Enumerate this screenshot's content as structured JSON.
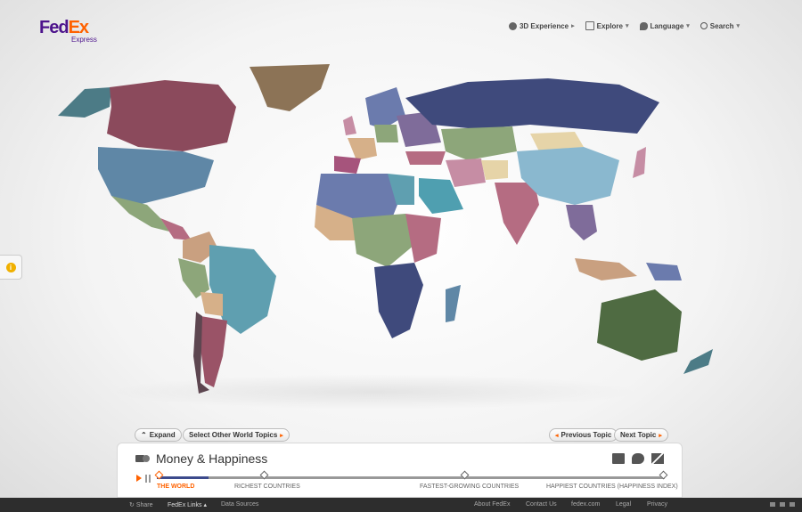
{
  "brand": {
    "logo_fed": "Fed",
    "logo_ex": "Ex",
    "logo_sub": "Express"
  },
  "topnav": [
    {
      "label": "3D Experience",
      "icon": "globe-icon",
      "arrow": "▸"
    },
    {
      "label": "Explore",
      "icon": "sitemap-icon",
      "arrow": "▾"
    },
    {
      "label": "Language",
      "icon": "speech-bubble-icon",
      "arrow": "▾"
    },
    {
      "label": "Search",
      "icon": "search-icon",
      "arrow": "▾"
    }
  ],
  "info_tab": {
    "label": "i"
  },
  "controls": {
    "expand": "Expand",
    "select_topics": "Select Other World Topics",
    "previous_topic": "Previous Topic",
    "next_topic": "Next Topic"
  },
  "panel": {
    "title": "Money & Happiness",
    "timeline": [
      {
        "label": "THE WORLD",
        "active": true
      },
      {
        "label": "RICHEST COUNTRIES",
        "active": false
      },
      {
        "label": "FASTEST-GROWING COUNTRIES",
        "active": false
      },
      {
        "label": "HAPPIEST COUNTRIES (HAPPINESS INDEX)",
        "active": false
      }
    ]
  },
  "footer": {
    "share": "Share",
    "fedex_links": "FedEx Links",
    "data_sources": "Data Sources",
    "about": "About FedEx",
    "contact": "Contact Us",
    "site": "fedex.com",
    "legal": "Legal",
    "privacy": "Privacy"
  },
  "colors": {
    "accent": "#ff6200",
    "brand_purple": "#4d148c",
    "footer_bg": "#2d2d2d"
  }
}
